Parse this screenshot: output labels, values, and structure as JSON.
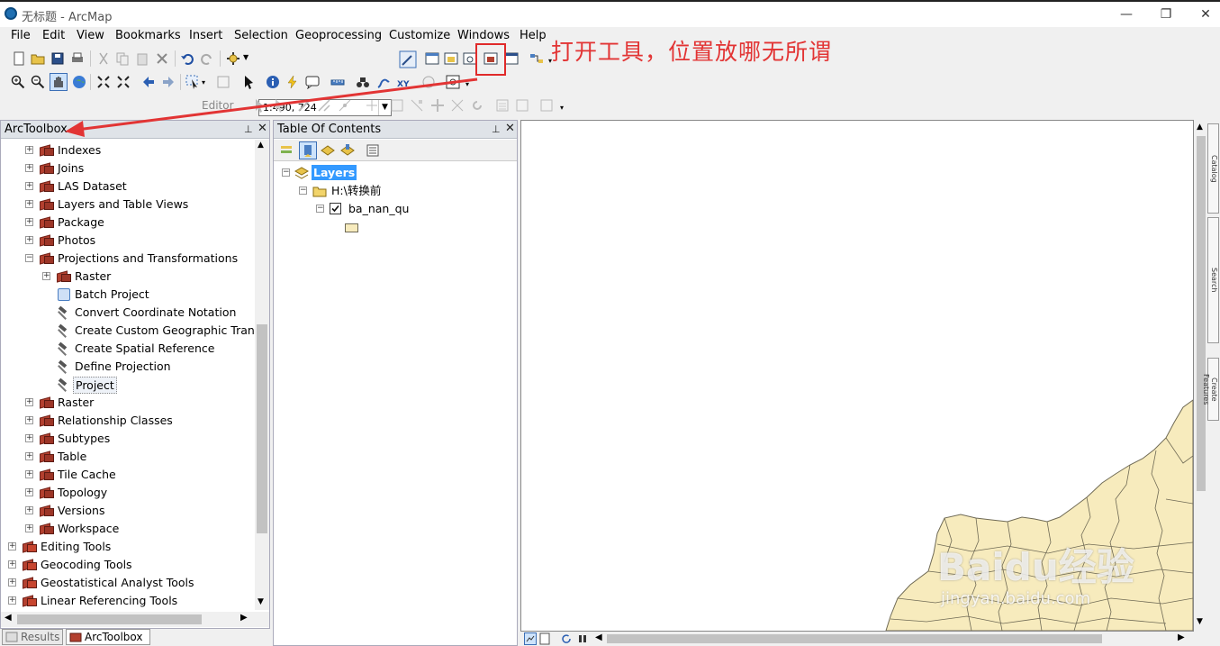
{
  "window": {
    "title": "无标题 - ArcMap",
    "controls": [
      "—",
      "❐",
      "✕"
    ]
  },
  "menu": [
    "File",
    "Edit",
    "View",
    "Bookmarks",
    "Insert",
    "Selection",
    "Geoprocessing",
    "Customize",
    "Windows",
    "Help"
  ],
  "toolbar": {
    "scale_value": "1:490, 724",
    "editor_label": "Editor"
  },
  "annotation": "打开工具，位置放哪无所谓",
  "arctoolbox": {
    "title": "ArcToolbox",
    "items": [
      {
        "label": "Indexes",
        "type": "toolset"
      },
      {
        "label": "Joins",
        "type": "toolset"
      },
      {
        "label": "LAS Dataset",
        "type": "toolset"
      },
      {
        "label": "Layers and Table Views",
        "type": "toolset"
      },
      {
        "label": "Package",
        "type": "toolset"
      },
      {
        "label": "Photos",
        "type": "toolset"
      },
      {
        "label": "Projections and Transformations",
        "type": "toolset"
      },
      {
        "label": "Raster",
        "type": "toolset"
      },
      {
        "label": "Batch Project",
        "type": "script"
      },
      {
        "label": "Convert Coordinate Notation",
        "type": "tool"
      },
      {
        "label": "Create Custom Geographic Transf",
        "type": "tool"
      },
      {
        "label": "Create Spatial Reference",
        "type": "tool"
      },
      {
        "label": "Define Projection",
        "type": "tool"
      },
      {
        "label": "Project",
        "type": "tool"
      },
      {
        "label": "Raster",
        "type": "toolset"
      },
      {
        "label": "Relationship Classes",
        "type": "toolset"
      },
      {
        "label": "Subtypes",
        "type": "toolset"
      },
      {
        "label": "Table",
        "type": "toolset"
      },
      {
        "label": "Tile Cache",
        "type": "toolset"
      },
      {
        "label": "Topology",
        "type": "toolset"
      },
      {
        "label": "Versions",
        "type": "toolset"
      },
      {
        "label": "Workspace",
        "type": "toolset"
      },
      {
        "label": "Editing Tools",
        "type": "toolbox"
      },
      {
        "label": "Geocoding Tools",
        "type": "toolbox"
      },
      {
        "label": "Geostatistical Analyst Tools",
        "type": "toolbox"
      },
      {
        "label": "Linear Referencing Tools",
        "type": "toolbox"
      }
    ]
  },
  "tabs": {
    "results": "Results",
    "arctoolbox": "ArcToolbox"
  },
  "toc": {
    "title": "Table Of Contents",
    "layers": "Layers",
    "folder": "H:\\转换前",
    "layer": "ba_nan_qu"
  },
  "right_dock": [
    "Catalog",
    "Search",
    "Create Features"
  ],
  "watermark": {
    "main": "Baidu经验",
    "sub": "jingyan.baidu.com"
  },
  "colors": {
    "map_fill": "#f7ebbd",
    "map_stroke": "#6f6a55",
    "annotation_red": "#e23434",
    "selection_blue": "#3399ff"
  }
}
